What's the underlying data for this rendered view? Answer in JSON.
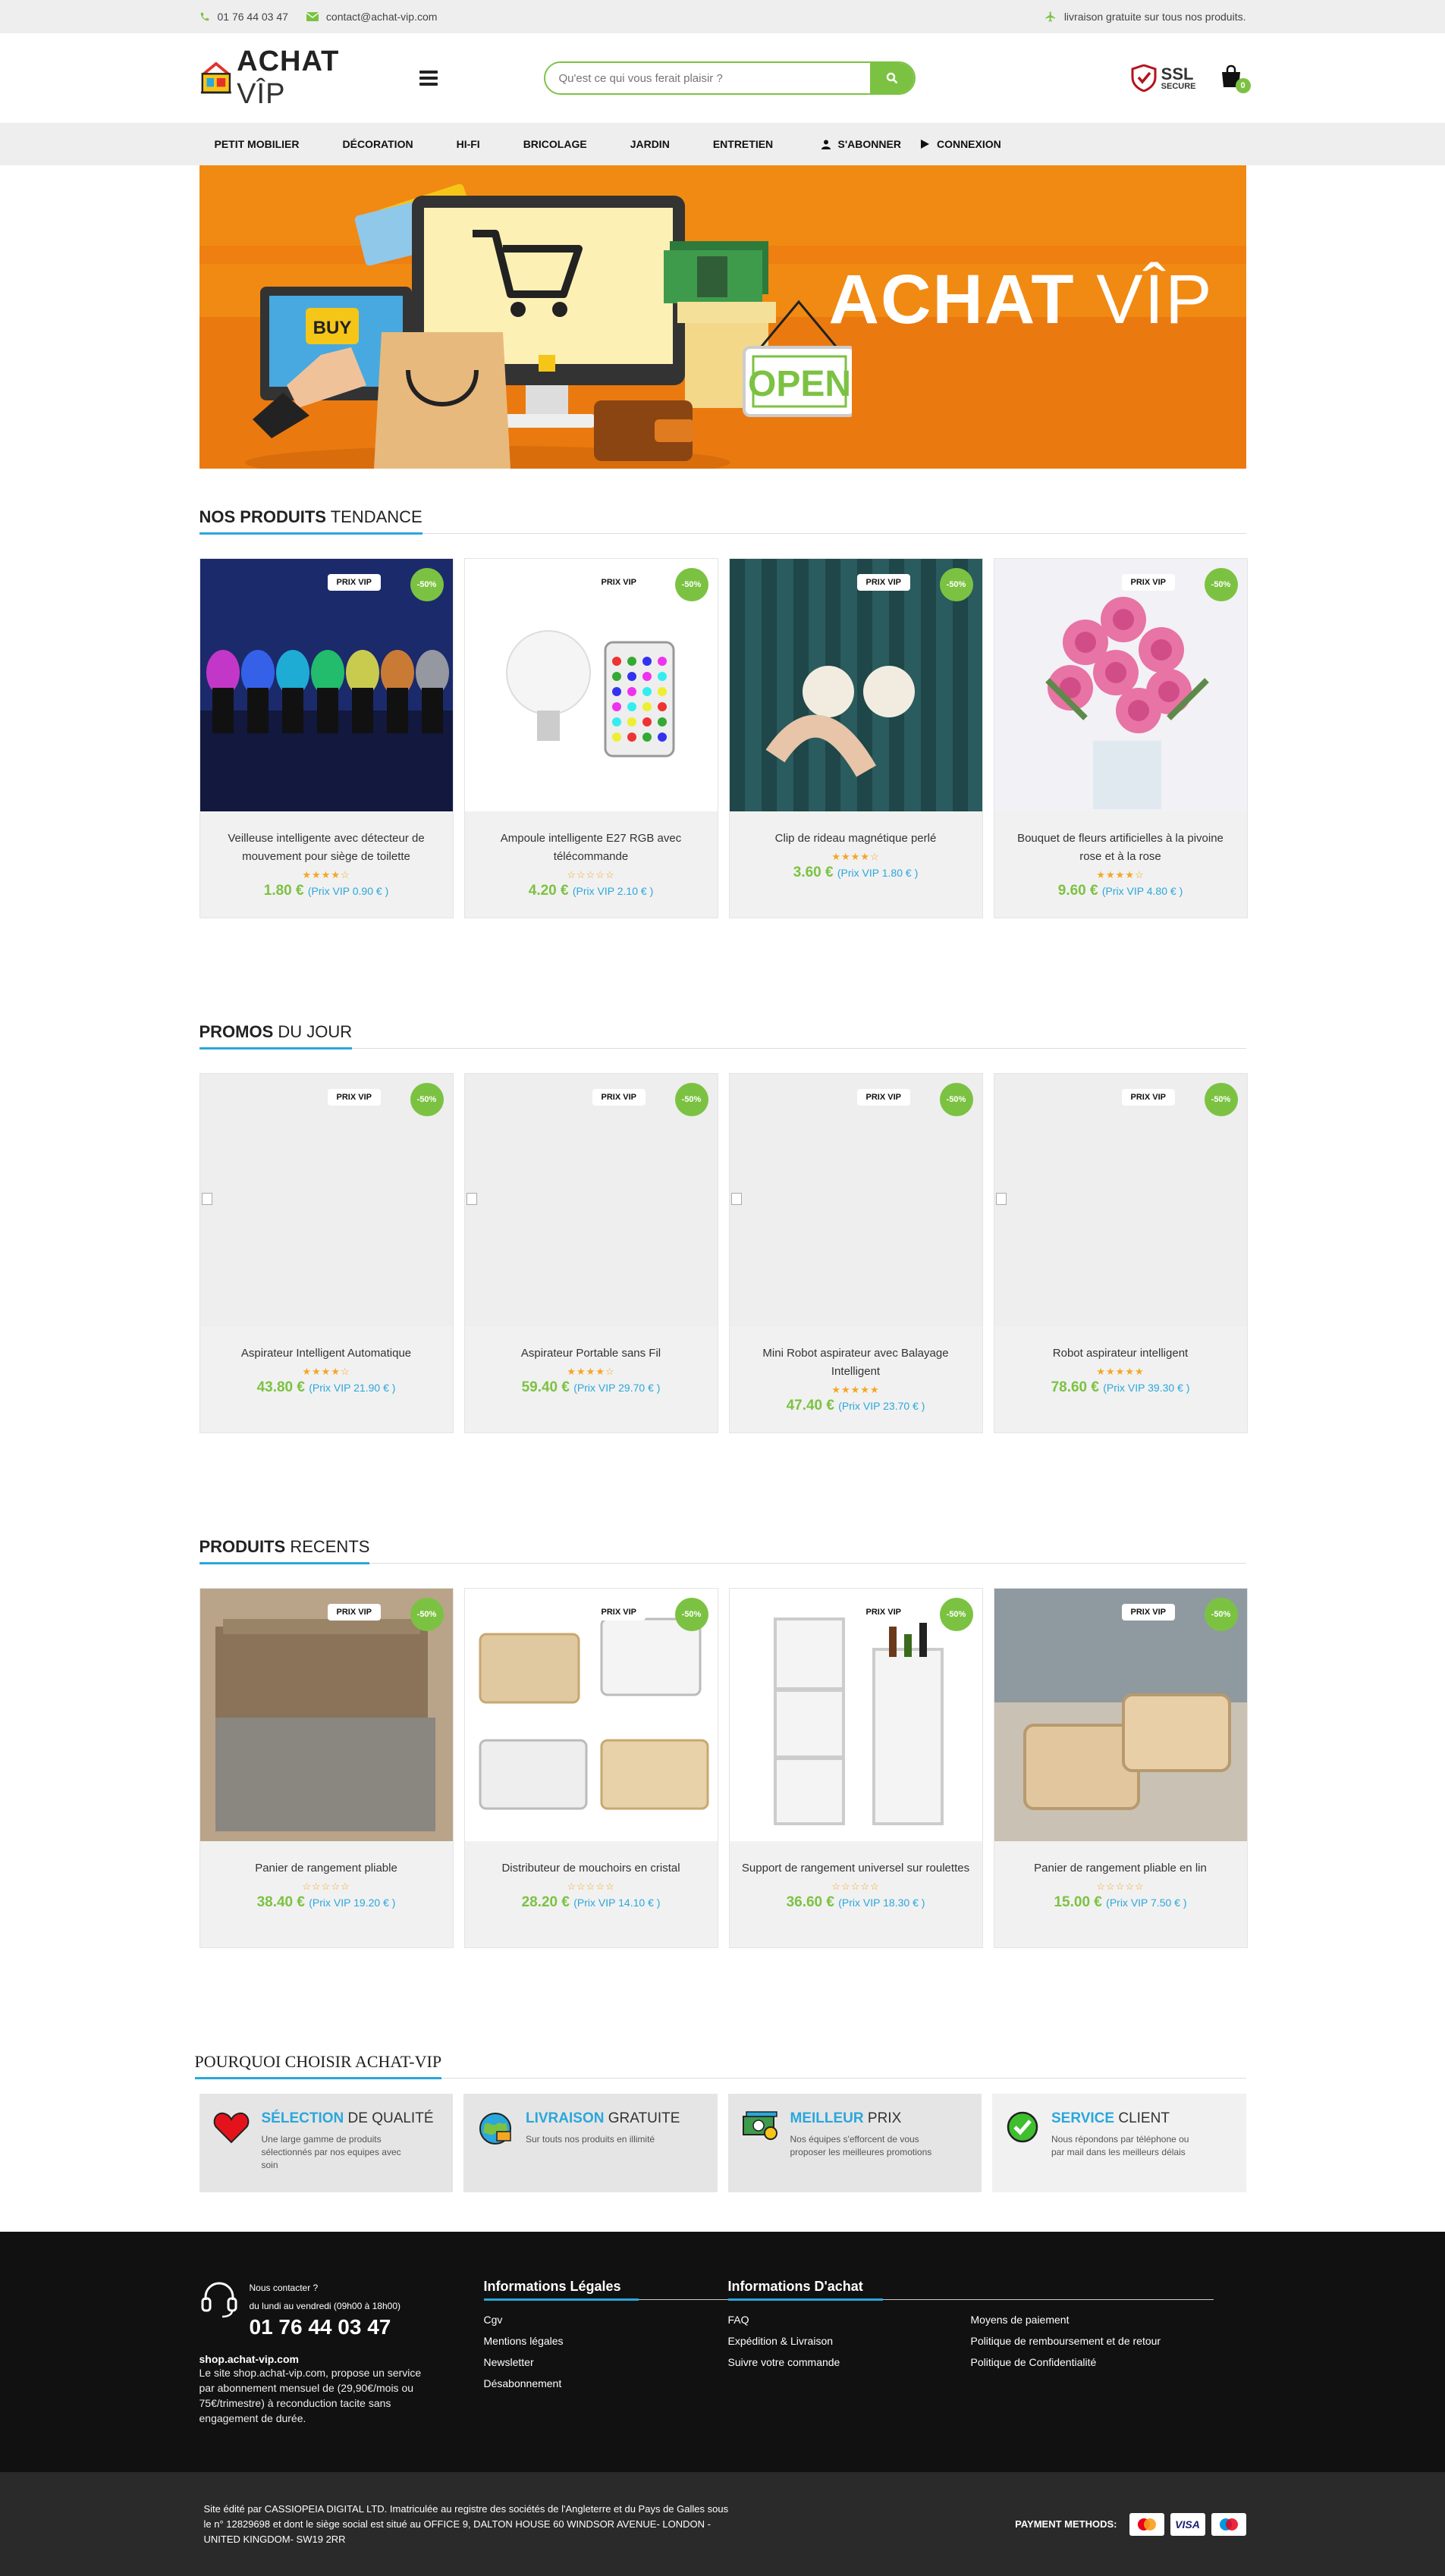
{
  "topbar": {
    "phone": "01 76 44 03 47",
    "email": "contact@achat-vip.com",
    "shipping": "livraison gratuite sur tous nos produits."
  },
  "header": {
    "logo_main": "ACHAT",
    "logo_vip": "VÎP",
    "search_placeholder": "Qu'est ce qui vous ferait plaisir ?",
    "ssl_big": "SSL",
    "ssl_small": "SECURE",
    "cart_count": "0"
  },
  "nav": {
    "items": [
      "PETIT MOBILIER",
      "DÉCORATION",
      "HI-FI",
      "BRICOLAGE",
      "JARDIN",
      "ENTRETIEN"
    ],
    "subscribe": "S'ABONNER",
    "login": "CONNEXION"
  },
  "banner": {
    "title_main": "ACHAT",
    "title_vip": "VÎP",
    "buy": "BUY",
    "open": "OPEN"
  },
  "sections": [
    {
      "title_bold": "NOS PRODUITS",
      "title_rest": "TENDANCE",
      "products": [
        {
          "name": "Veilleuse intelligente avec détecteur de mouvement pour siège de toilette",
          "stars": "★★★★☆",
          "price": "1.80 €",
          "vip_label": "(Prix VIP",
          "vip_price": "0.90 €",
          "vip_close": ")",
          "badge": "PRIX VIP",
          "discount": "-50%"
        },
        {
          "name": "Ampoule intelligente E27 RGB avec télécommande",
          "stars": "☆☆☆☆☆",
          "price": "4.20 €",
          "vip_label": "(Prix VIP",
          "vip_price": "2.10 €",
          "vip_close": ")",
          "badge": "PRIX VIP",
          "discount": "-50%"
        },
        {
          "name": "Clip de rideau magnétique perlé",
          "stars": "★★★★☆",
          "price": "3.60 €",
          "vip_label": "(Prix VIP",
          "vip_price": "1.80 €",
          "vip_close": ")",
          "badge": "PRIX VIP",
          "discount": "-50%"
        },
        {
          "name": "Bouquet de fleurs artificielles à la pivoine rose et à la rose",
          "stars": "★★★★☆",
          "price": "9.60 €",
          "vip_label": "(Prix VIP",
          "vip_price": "4.80 €",
          "vip_close": ")",
          "badge": "PRIX VIP",
          "discount": "-50%"
        }
      ]
    },
    {
      "title_bold": "PROMOS",
      "title_rest": "DU JOUR",
      "products": [
        {
          "name": "Aspirateur Intelligent Automatique",
          "stars": "★★★★☆",
          "price": "43.80 €",
          "vip_label": "(Prix VIP",
          "vip_price": "21.90 €",
          "vip_close": ")",
          "badge": "PRIX VIP",
          "discount": "-50%"
        },
        {
          "name": "Aspirateur Portable sans Fil",
          "stars": "★★★★☆",
          "price": "59.40 €",
          "vip_label": "(Prix VIP",
          "vip_price": "29.70 €",
          "vip_close": ")",
          "badge": "PRIX VIP",
          "discount": "-50%"
        },
        {
          "name": "Mini Robot aspirateur avec Balayage Intelligent",
          "stars": "★★★★★",
          "price": "47.40 €",
          "vip_label": "(Prix VIP",
          "vip_price": "23.70 €",
          "vip_close": ")",
          "badge": "PRIX VIP",
          "discount": "-50%"
        },
        {
          "name": "Robot aspirateur intelligent",
          "stars": "★★★★★",
          "price": "78.60 €",
          "vip_label": "(Prix VIP",
          "vip_price": "39.30 €",
          "vip_close": ")",
          "badge": "PRIX VIP",
          "discount": "-50%"
        }
      ]
    },
    {
      "title_bold": "PRODUITS",
      "title_rest": "RECENTS",
      "products": [
        {
          "name": "Panier de rangement pliable",
          "stars": "☆☆☆☆☆",
          "price": "38.40 €",
          "vip_label": "(Prix VIP",
          "vip_price": "19.20 €",
          "vip_close": ")",
          "badge": "PRIX VIP",
          "discount": "-50%"
        },
        {
          "name": "Distributeur de mouchoirs en cristal",
          "stars": "☆☆☆☆☆",
          "price": "28.20 €",
          "vip_label": "(Prix VIP",
          "vip_price": "14.10 €",
          "vip_close": ")",
          "badge": "PRIX VIP",
          "discount": "-50%"
        },
        {
          "name": "Support de rangement universel sur roulettes",
          "stars": "☆☆☆☆☆",
          "price": "36.60 €",
          "vip_label": "(Prix VIP",
          "vip_price": "18.30 €",
          "vip_close": ")",
          "badge": "PRIX VIP",
          "discount": "-50%"
        },
        {
          "name": "Panier de rangement pliable en lin",
          "stars": "☆☆☆☆☆",
          "price": "15.00 €",
          "vip_label": "(Prix VIP",
          "vip_price": "7.50 €",
          "vip_close": ")",
          "badge": "PRIX VIP",
          "discount": "-50%"
        }
      ]
    }
  ],
  "why": {
    "title_bold": "POURQUOI CHOISIR",
    "title_rest": "ACHAT-VIP",
    "items": [
      {
        "hl": "SÉLECTION",
        "rest": "DE QUALITÉ",
        "desc": "Une large gamme de produits sélectionnés par nos equipes avec soin",
        "icon": "heart-icon"
      },
      {
        "hl": "LIVRAISON",
        "rest": "GRATUITE",
        "desc": "Sur touts nos produits en illimité",
        "icon": "globe-delivery-icon"
      },
      {
        "hl": "MEILLEUR",
        "rest": "PRIX",
        "desc": "Nos équipes s'efforcent de vous proposer les meilleures promotions",
        "icon": "money-icon"
      },
      {
        "hl": "SERVICE",
        "rest": "CLIENT",
        "desc": "Nous répondons par téléphone ou par mail dans les meilleurs délais",
        "icon": "check-circle-icon"
      }
    ]
  },
  "footer": {
    "contact_label": "Nous contacter ?",
    "hours": "du lundi au vendredi (09h00 à 18h00)",
    "phone": "01 76 44 03 47",
    "site": "shop.achat-vip.com",
    "desc": "Le site shop.achat-vip.com, propose un service par abonnement mensuel de (29,90€/mois ou 75€/trimestre) à reconduction tacite sans engagement de durée.",
    "legal_title": "Informations Légales",
    "legal_links": [
      "Cgv",
      "Mentions légales",
      "Newsletter",
      "Désabonnement"
    ],
    "achat_title": "Informations D'achat",
    "achat_links_1": [
      "FAQ",
      "Expédition & Livraison",
      "Suivre votre commande"
    ],
    "achat_links_2": [
      "Moyens de paiement",
      "Politique de remboursement et de retour",
      "Politique de Confidentialité"
    ]
  },
  "bottom": {
    "legal": "Site édité par CASSIOPEIA DIGITAL LTD. Imatriculée au registre des sociétés de l'Angleterre et du Pays de Galles sous le n° 12829698 et dont le siège social est situé au OFFICE 9, DALTON HOUSE 60 WINDSOR AVENUE- LONDON - UNITED KINGDOM- SW19 2RR",
    "payment_label": "PAYMENT METHODS:",
    "visa": "VISA"
  }
}
